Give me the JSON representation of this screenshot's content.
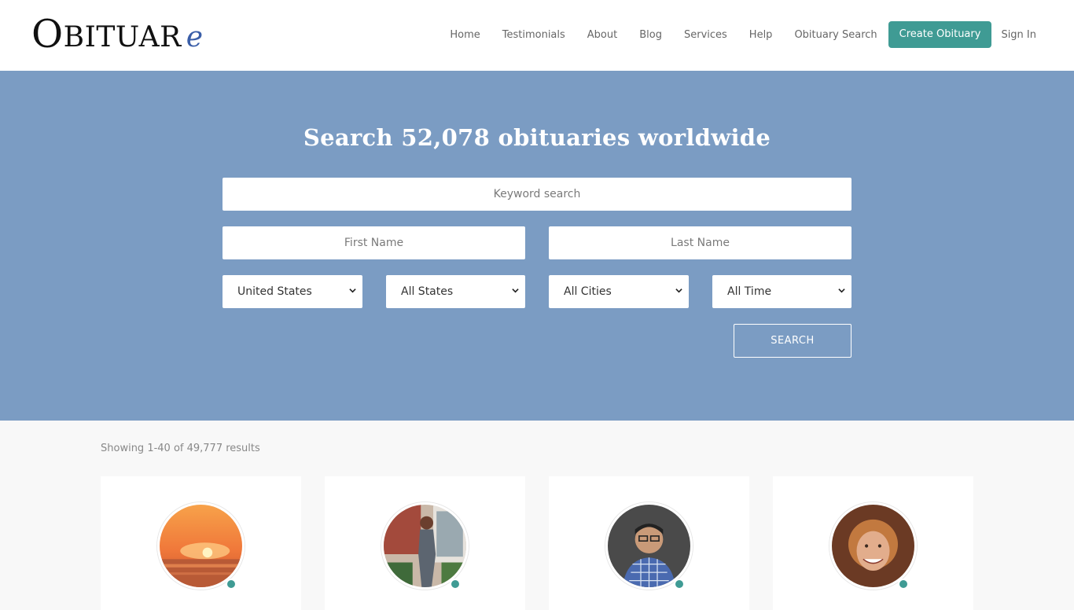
{
  "logo": {
    "part1": "O",
    "part2": "BITUAR",
    "part3": "e"
  },
  "nav": {
    "items": [
      "Home",
      "Testimonials",
      "About",
      "Blog",
      "Services",
      "Help",
      "Obituary Search"
    ],
    "create": "Create Obituary",
    "signin": "Sign In"
  },
  "hero": {
    "title": "Search 52,078 obituaries worldwide",
    "keyword_placeholder": "Keyword search",
    "first_name_placeholder": "First Name",
    "last_name_placeholder": "Last Name",
    "country": "United States",
    "state": "All States",
    "city": "All Cities",
    "time": "All Time",
    "search_label": "SEARCH"
  },
  "results": {
    "count_text": "Showing 1-40 of 49,777 results"
  },
  "colors": {
    "accent": "#3f9b94",
    "hero_bg": "#7b9cc3",
    "logo_e": "#3a5ea8"
  }
}
